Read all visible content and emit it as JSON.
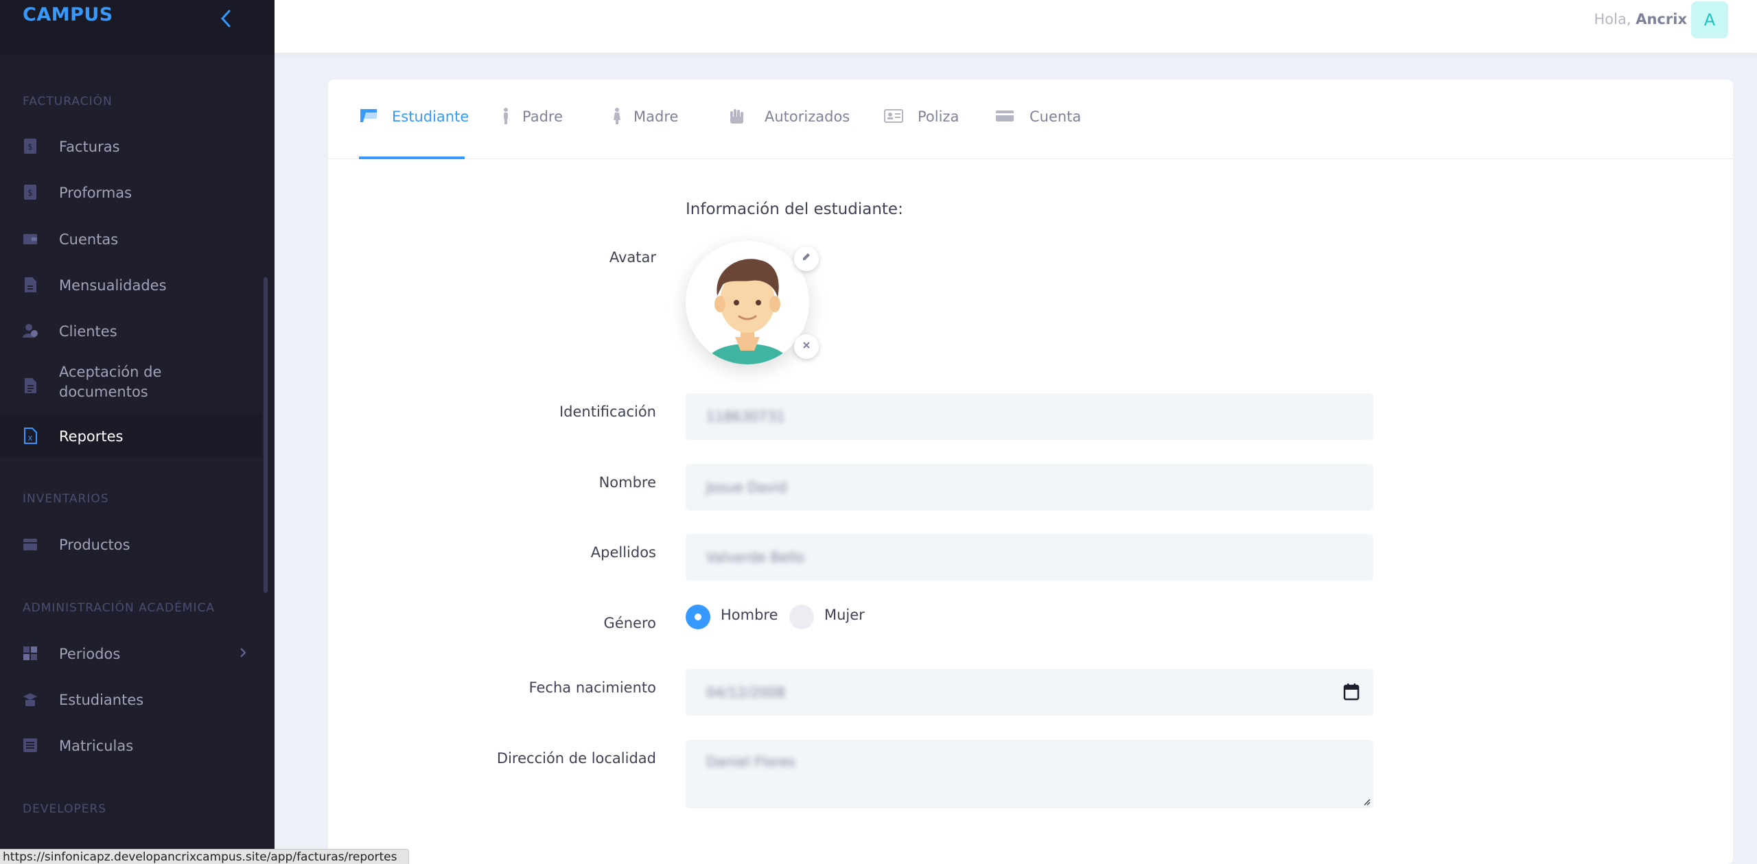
{
  "brand": {
    "title": "CAMPUS"
  },
  "sidebar": {
    "sections": [
      {
        "title": "FACTURACIÓN"
      },
      {
        "title": "INVENTARIOS"
      },
      {
        "title": "ADMINISTRACIÓN ACADÉMICA"
      },
      {
        "title": "DEVELOPERS"
      }
    ],
    "items": [
      {
        "label": "Facturas",
        "icon": "invoice-icon"
      },
      {
        "label": "Proformas",
        "icon": "invoice-icon"
      },
      {
        "label": "Cuentas",
        "icon": "wallet-icon"
      },
      {
        "label": "Mensualidades",
        "icon": "document-icon"
      },
      {
        "label": "Clientes",
        "icon": "users-icon"
      },
      {
        "label": "Aceptación de documentos",
        "icon": "file-check-icon"
      },
      {
        "label": "Reportes",
        "icon": "excel-file-icon",
        "active": true
      },
      {
        "label": "Productos",
        "icon": "box-icon"
      },
      {
        "label": "Periodos",
        "icon": "grid-icon",
        "has_submenu": true
      },
      {
        "label": "Estudiantes",
        "icon": "graduation-icon"
      },
      {
        "label": "Matriculas",
        "icon": "list-icon"
      }
    ]
  },
  "topbar": {
    "greeting": "Hola,",
    "user_name": "Ancrix",
    "avatar_letter": "A"
  },
  "tabs": [
    {
      "label": "Estudiante",
      "icon": "student-icon",
      "active": true
    },
    {
      "label": "Padre",
      "icon": "man-icon"
    },
    {
      "label": "Madre",
      "icon": "woman-icon"
    },
    {
      "label": "Autorizados",
      "icon": "hand-icon"
    },
    {
      "label": "Poliza",
      "icon": "id-card-icon"
    },
    {
      "label": "Cuenta",
      "icon": "card-icon"
    }
  ],
  "form": {
    "heading": "Información del estudiante:",
    "avatar_label": "Avatar",
    "identificacion": {
      "label": "Identificación",
      "value": "118630731"
    },
    "nombre": {
      "label": "Nombre",
      "value": "Josue David"
    },
    "apellidos": {
      "label": "Apellidos",
      "value": "Valverde Bello"
    },
    "genero": {
      "label": "Género",
      "options": [
        "Hombre",
        "Mujer"
      ],
      "selected": "Hombre"
    },
    "fecha_nacimiento": {
      "label": "Fecha nacimiento",
      "value": "04/12/2008"
    },
    "direccion": {
      "label": "Dirección de localidad",
      "value": "Daniel Flores"
    }
  },
  "status_url": "https://sinfonicapz.developancrixcampus.site/app/facturas/reportes",
  "colors": {
    "accent": "#3699ff",
    "sidebar_bg": "#1e1e2d",
    "brand": "#3699ff"
  }
}
